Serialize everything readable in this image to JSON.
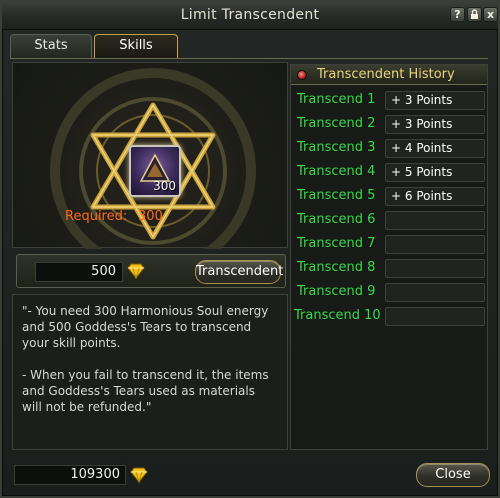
{
  "window": {
    "title": "Limit Transcendent",
    "help_icon": "?",
    "lock_icon": "lock-icon",
    "close_icon": "x"
  },
  "tabs": [
    {
      "label": "Stats",
      "active": false
    },
    {
      "label": "Skills",
      "active": true
    }
  ],
  "item": {
    "count": "300",
    "required_label": "Required:",
    "required_value": "300"
  },
  "cost": {
    "value": "500",
    "icon": "gem-icon",
    "button_label": "Transcendent"
  },
  "description": "\"- You need 300 Harmonious Soul energy\n and 500 Goddess's Tears to transcend\nyour skill points.\n\n- When you fail to transcend it, the items\nand Goddess's Tears used as materials\nwill not be refunded.\"",
  "history": {
    "title": "Transcendent History",
    "rows": [
      {
        "label": "Transcend 1",
        "value": "+  3 Points"
      },
      {
        "label": "Transcend 2",
        "value": "+  3 Points"
      },
      {
        "label": "Transcend 3",
        "value": "+  4 Points"
      },
      {
        "label": "Transcend 4",
        "value": "+  5 Points"
      },
      {
        "label": "Transcend 5",
        "value": "+  6 Points"
      },
      {
        "label": "Transcend 6",
        "value": ""
      },
      {
        "label": "Transcend 7",
        "value": ""
      },
      {
        "label": "Transcend 8",
        "value": ""
      },
      {
        "label": "Transcend 9",
        "value": ""
      },
      {
        "label": "Transcend 10",
        "value": ""
      }
    ]
  },
  "footer": {
    "balance": "109300",
    "close_label": "Close"
  },
  "colors": {
    "green_label": "#38d84a",
    "orange_required": "#ff6a1a",
    "gold_border": "#c8a24a",
    "history_title": "#e9d37a"
  }
}
